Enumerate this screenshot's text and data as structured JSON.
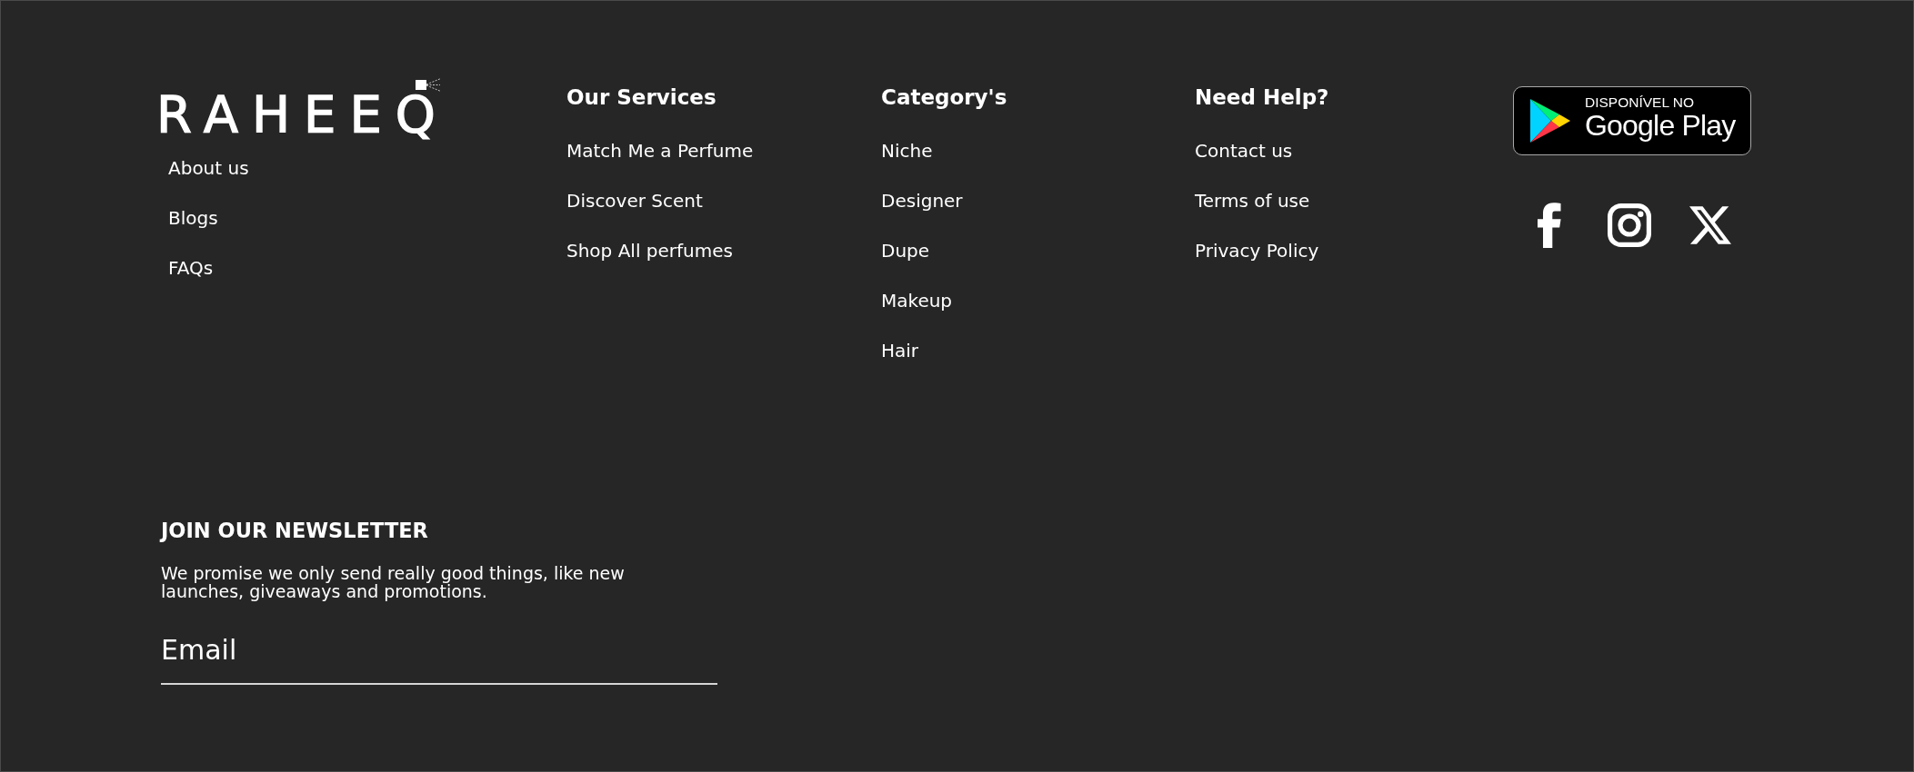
{
  "brand": {
    "logo": "RAHEEQ",
    "links": [
      "About us",
      "Blogs",
      "FAQs"
    ]
  },
  "columns": [
    {
      "title": "Our Services",
      "links": [
        "Match Me a Perfume",
        "Discover Scent",
        "Shop All perfumes"
      ]
    },
    {
      "title": "Category's",
      "links": [
        "Niche",
        "Designer",
        "Dupe",
        "Makeup",
        "Hair"
      ]
    },
    {
      "title": "Need Help?",
      "links": [
        "Contact us",
        "Terms of use",
        "Privacy Policy"
      ]
    }
  ],
  "app_badge": {
    "caption": "DISPONÍVEL NO",
    "store": "Google Play"
  },
  "newsletter": {
    "title": "JOIN OUR NEWSLETTER",
    "text": "We promise we only send really good things, like new launches, giveaways and promotions.",
    "email": {
      "placeholder": "Email"
    }
  }
}
